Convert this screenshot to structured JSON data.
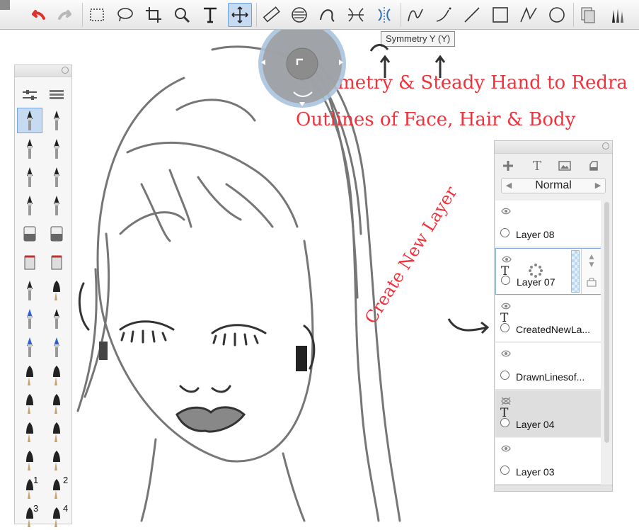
{
  "toolbar": {
    "buttons": [
      {
        "name": "undo-icon",
        "label": "Undo"
      },
      {
        "name": "redo-icon",
        "label": "Redo"
      },
      {
        "name": "rect-select-icon",
        "label": "Rectangle Select"
      },
      {
        "name": "lasso-icon",
        "label": "Lasso"
      },
      {
        "name": "crop-icon",
        "label": "Crop"
      },
      {
        "name": "magnifier-icon",
        "label": "Zoom"
      },
      {
        "name": "text-icon",
        "label": "Text"
      },
      {
        "name": "transform-icon",
        "label": "Transform"
      },
      {
        "name": "ruler-icon",
        "label": "Ruler"
      },
      {
        "name": "ellipse-guide-icon",
        "label": "Ellipse Guide"
      },
      {
        "name": "french-curve-icon",
        "label": "French Curve"
      },
      {
        "name": "symmetry-x-icon",
        "label": "Symmetry X"
      },
      {
        "name": "symmetry-y-icon",
        "label": "Symmetry Y"
      },
      {
        "name": "curve-icon",
        "label": "Curve"
      },
      {
        "name": "steady-stroke-icon",
        "label": "Steady Stroke"
      },
      {
        "name": "line-icon",
        "label": "Line"
      },
      {
        "name": "rectangle-icon",
        "label": "Rectangle"
      },
      {
        "name": "polyline-icon",
        "label": "Polyline"
      },
      {
        "name": "circle-icon",
        "label": "Circle"
      },
      {
        "name": "layer-editor-icon",
        "label": "Layer Editor"
      },
      {
        "name": "brush-library-icon",
        "label": "Brush Library"
      }
    ],
    "tooltip": "Symmetry Y (Y)",
    "accent": "#6b9fd8"
  },
  "canvas": {
    "annotation_line1": "Symmetry & Steady Hand to Redra",
    "annotation_line2": "Outlines of Face, Hair & Body",
    "annotation_side": "Create New Layer",
    "annotation_color": "#f0323c"
  },
  "brush_palette": {
    "numbers": [
      "1",
      "2",
      "3",
      "4"
    ]
  },
  "layer_panel": {
    "blend_mode": "Normal",
    "layers": [
      {
        "name": "Layer 08",
        "type": "paint",
        "state": "normal"
      },
      {
        "name": "Layer 07",
        "type": "text",
        "state": "selected"
      },
      {
        "name": "CreatedNewLa...",
        "type": "text",
        "state": "normal"
      },
      {
        "name": "DrawnLinesof...",
        "type": "paint",
        "state": "normal"
      },
      {
        "name": "Layer 04",
        "type": "text",
        "state": "hidden"
      },
      {
        "name": "Layer 03",
        "type": "paint",
        "state": "normal"
      }
    ]
  }
}
